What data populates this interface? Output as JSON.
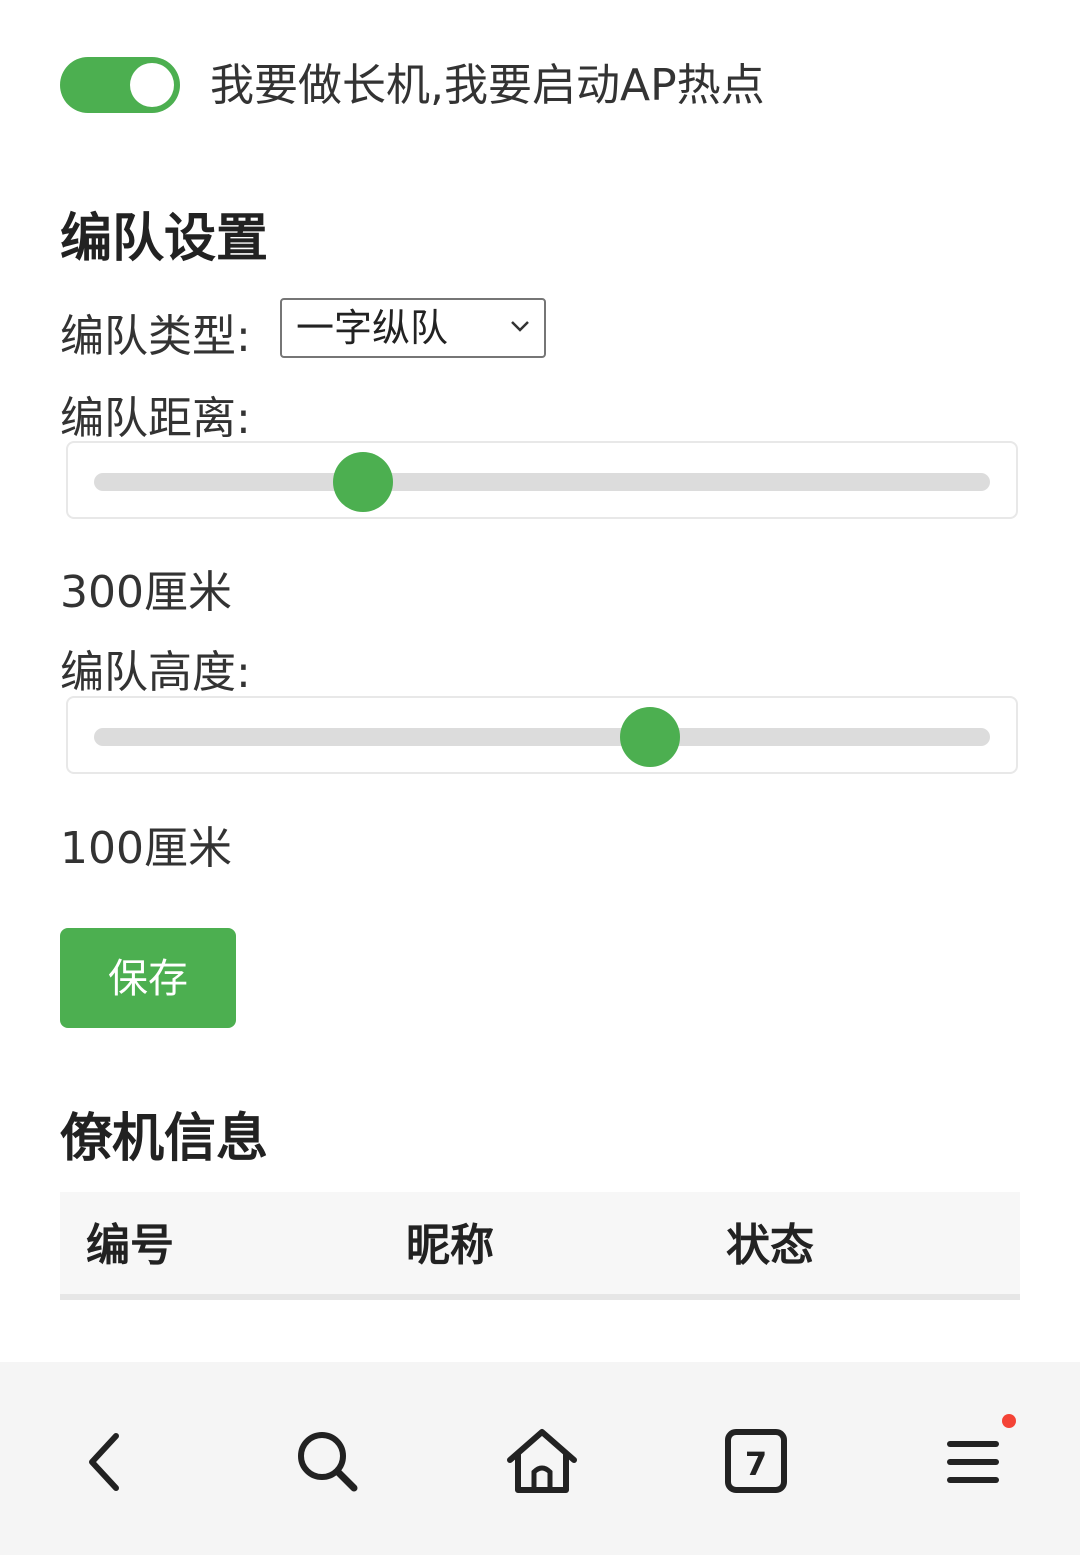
{
  "ap_toggle": {
    "label": "我要做长机,我要启动AP热点",
    "enabled": true
  },
  "formation": {
    "title": "编队设置",
    "type_label": "编队类型:",
    "type_value": "一字纵队",
    "distance_label": "编队距离:",
    "distance_value": "300厘米",
    "distance_level": 0.3,
    "height_label": "编队高度:",
    "height_value": "100厘米",
    "height_level": 0.62,
    "save_label": "保存"
  },
  "wingman": {
    "title": "僚机信息",
    "columns": [
      "编号",
      "昵称",
      "状态"
    ]
  },
  "browser_bar": {
    "tab_count": "7",
    "icons": [
      "back-icon",
      "search-icon",
      "home-icon",
      "tabs-icon",
      "menu-icon"
    ],
    "notification_dot_color": "#f44336"
  },
  "colors": {
    "accent": "#4caf50"
  }
}
